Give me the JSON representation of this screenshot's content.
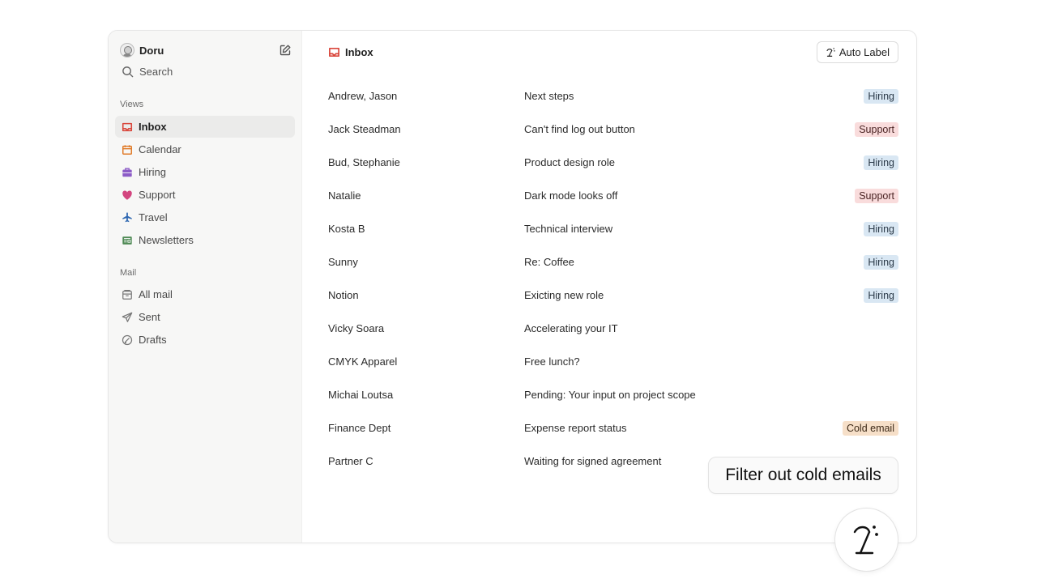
{
  "user": {
    "name": "Doru"
  },
  "search": {
    "label": "Search"
  },
  "sections": {
    "views": "Views",
    "mail": "Mail"
  },
  "views": [
    {
      "label": "Inbox",
      "icon": "inbox-icon",
      "color": "#d9463b",
      "active": true
    },
    {
      "label": "Calendar",
      "icon": "calendar-icon",
      "color": "#e07b2a"
    },
    {
      "label": "Hiring",
      "icon": "briefcase-icon",
      "color": "#8c5cc7"
    },
    {
      "label": "Support",
      "icon": "heart-icon",
      "color": "#d3457f"
    },
    {
      "label": "Travel",
      "icon": "airplane-icon",
      "color": "#2e67b1"
    },
    {
      "label": "Newsletters",
      "icon": "newspaper-icon",
      "color": "#4f8a55"
    }
  ],
  "mail_nav": [
    {
      "label": "All mail",
      "icon": "archive-icon"
    },
    {
      "label": "Sent",
      "icon": "send-icon"
    },
    {
      "label": "Drafts",
      "icon": "drafts-icon"
    }
  ],
  "main": {
    "title": "Inbox",
    "auto_label": "Auto Label"
  },
  "emails": [
    {
      "sender": "Andrew, Jason",
      "subject": "Next steps",
      "tag": "Hiring",
      "tag_type": "hiring"
    },
    {
      "sender": "Jack Steadman",
      "subject": "Can't find log out button",
      "tag": "Support",
      "tag_type": "support"
    },
    {
      "sender": "Bud, Stephanie",
      "subject": "Product design role",
      "tag": "Hiring",
      "tag_type": "hiring"
    },
    {
      "sender": "Natalie",
      "subject": "Dark mode looks off",
      "tag": "Support",
      "tag_type": "support"
    },
    {
      "sender": "Kosta B",
      "subject": "Technical interview",
      "tag": "Hiring",
      "tag_type": "hiring"
    },
    {
      "sender": "Sunny",
      "subject": "Re: Coffee",
      "tag": "Hiring",
      "tag_type": "hiring"
    },
    {
      "sender": "Notion",
      "subject": "Exicting new role",
      "tag": "Hiring",
      "tag_type": "hiring"
    },
    {
      "sender": "Vicky Soara",
      "subject": "Accelerating your IT",
      "tag": "",
      "tag_type": "empty"
    },
    {
      "sender": "CMYK Apparel",
      "subject": "Free lunch?",
      "tag": "",
      "tag_type": "empty"
    },
    {
      "sender": "Michai Loutsa",
      "subject": "Pending: Your input on project scope",
      "tag": "",
      "tag_type": "empty"
    },
    {
      "sender": "Finance Dept",
      "subject": "Expense report status",
      "tag": "Cold email",
      "tag_type": "cold"
    },
    {
      "sender": "Partner C",
      "subject": "Waiting for signed agreement",
      "tag": "",
      "tag_type": "empty"
    }
  ],
  "assistant": {
    "prompt": "Filter out cold emails",
    "icon": "ai-assistant-icon"
  }
}
